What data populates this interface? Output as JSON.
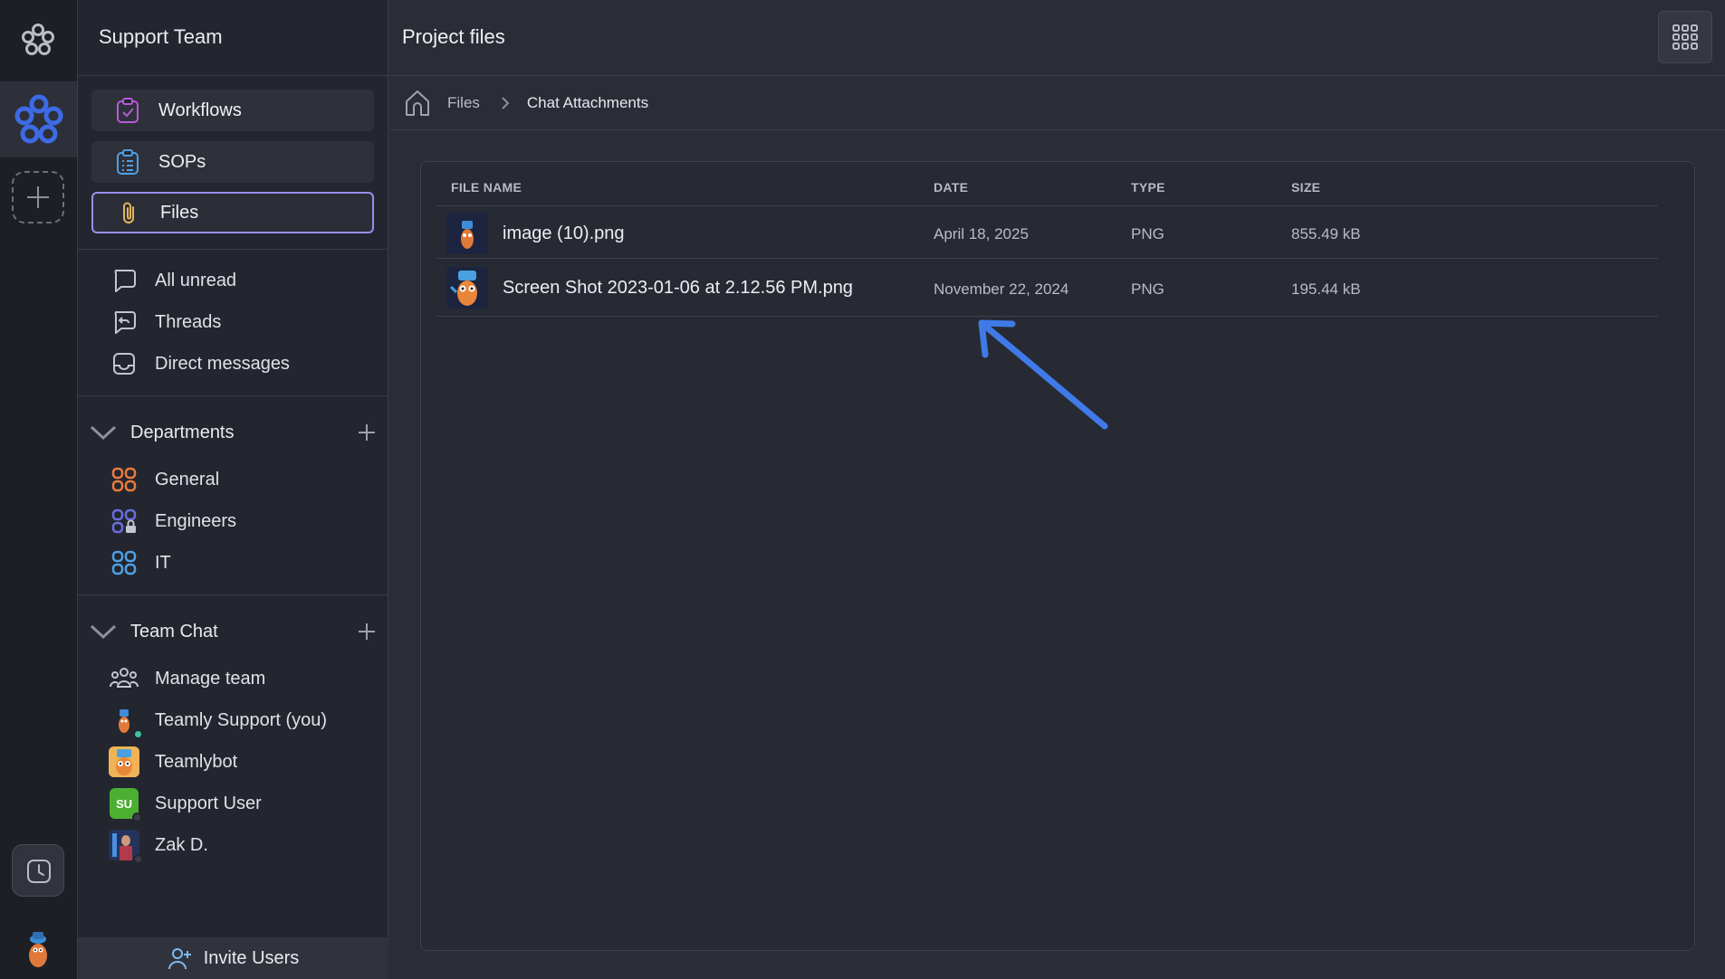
{
  "team": {
    "name": "Support Team"
  },
  "nav": [
    {
      "label": "Workflows",
      "icon": "clipboard-check-icon"
    },
    {
      "label": "SOPs",
      "icon": "clipboard-list-icon"
    },
    {
      "label": "Files",
      "icon": "paperclip-icon",
      "active": true
    }
  ],
  "inbox": [
    {
      "label": "All unread",
      "icon": "chat-bubble-icon"
    },
    {
      "label": "Threads",
      "icon": "thread-reply-icon"
    },
    {
      "label": "Direct messages",
      "icon": "inbox-icon"
    }
  ],
  "departments": {
    "title": "Departments",
    "items": [
      {
        "label": "General"
      },
      {
        "label": "Engineers"
      },
      {
        "label": "IT"
      }
    ]
  },
  "team_chat": {
    "title": "Team Chat",
    "items": [
      {
        "label": "Manage team"
      },
      {
        "label": "Teamly Support (you)"
      },
      {
        "label": "Teamlybot"
      },
      {
        "label": "Support User",
        "initials": "SU"
      },
      {
        "label": "Zak D."
      }
    ]
  },
  "invite": {
    "label": "Invite Users"
  },
  "main": {
    "title": "Project files",
    "breadcrumb": {
      "root": "Files",
      "current": "Chat Attachments"
    },
    "table": {
      "headers": {
        "name": "FILE NAME",
        "date": "DATE",
        "type": "TYPE",
        "size": "SIZE"
      },
      "rows": [
        {
          "name": "image (10).png",
          "date": "April 18, 2025",
          "type": "PNG",
          "size": "855.49 kB"
        },
        {
          "name": "Screen Shot 2023-01-06 at 2.12.56 PM.png",
          "date": "November 22, 2024",
          "type": "PNG",
          "size": "195.44 kB"
        }
      ]
    }
  },
  "colors": {
    "accent_blue": "#3d6ae6",
    "active_border": "#9b8cf0",
    "workflow_icon": "#b65bd8",
    "sop_icon": "#4ea0e6",
    "files_icon": "#e0b55a",
    "general_icon": "#ea7a3e",
    "engineers_icon": "#6a6ee0",
    "it_icon": "#4ea0e6",
    "support_user_avatar": "#4caf32",
    "annotation_arrow": "#3f7ae8"
  }
}
